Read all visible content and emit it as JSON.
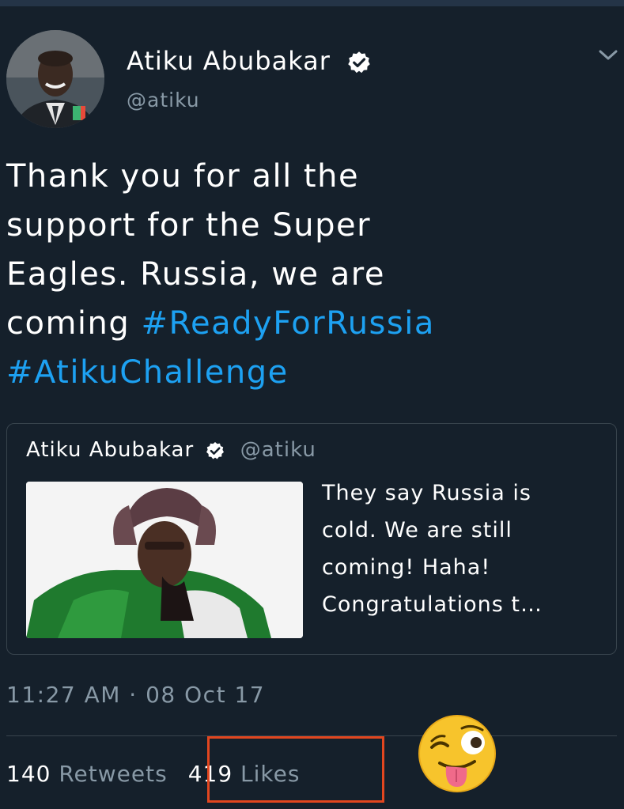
{
  "author": {
    "display_name": "Atiku Abubakar",
    "handle": "@atiku",
    "verified_icon": "verified-badge-icon"
  },
  "tweet": {
    "text_lines": [
      "Thank you for all the",
      "support for the Super",
      "Eagles. Russia, we are",
      "coming "
    ],
    "hashtag_1": "#ReadyForRussia",
    "hashtag_2": "#AtikuChallenge"
  },
  "quoted_tweet": {
    "display_name": "Atiku Abubakar",
    "handle": "@atiku",
    "text_lines": [
      "They say Russia is",
      "cold. We are still",
      "coming! Haha!",
      "Congratulations t…"
    ]
  },
  "timestamp": "11:27 AM · 08 Oct 17",
  "stats": {
    "retweets_count": "140",
    "retweets_label": "Retweets",
    "likes_count": "419",
    "likes_label": "Likes"
  },
  "colors": {
    "background": "#15202b",
    "hashtag": "#1da1f2",
    "secondary_text": "#8899a6",
    "highlight_box": "#e2461f",
    "border": "#38444d"
  },
  "overlay_icon": "winking-tongue-emoji-icon"
}
